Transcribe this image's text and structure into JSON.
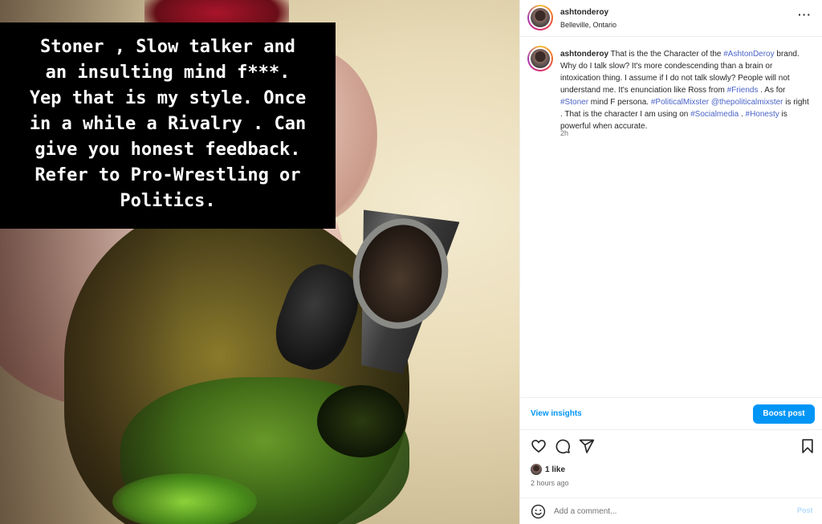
{
  "image_caption": {
    "lines": [
      "Stoner , Slow talker and",
      "an insulting mind f***.",
      "Yep that is my style. Once",
      "in a while a Rivalry . Can",
      "give you honest feedback.",
      "Refer to Pro-Wrestling or",
      "Politics."
    ]
  },
  "header": {
    "username": "ashtonderoy",
    "location": "Belleville, Ontario",
    "more_icon": "more-horizontal-icon",
    "more_glyph": "···"
  },
  "caption_comment": {
    "username": "ashtonderoy",
    "segments": [
      {
        "text": " That is the the Character of the ",
        "tag": false
      },
      {
        "text": "#AshtonDeroy",
        "tag": true
      },
      {
        "text": " brand. Why do I talk slow? It's more condescending than a brain or intoxication thing. I assume if I do not talk slowly? People will not understand me. It's enunciation like Ross from ",
        "tag": false
      },
      {
        "text": "#Friends",
        "tag": true
      },
      {
        "text": " . As for ",
        "tag": false
      },
      {
        "text": "#Stoner",
        "tag": true
      },
      {
        "text": " mind F persona. ",
        "tag": false
      },
      {
        "text": "#PoliticalMixster",
        "tag": true
      },
      {
        "text": " ",
        "tag": false
      },
      {
        "text": "@thepoliticalmixster",
        "tag": true
      },
      {
        "text": " is right . That is the character I am using on ",
        "tag": false
      },
      {
        "text": "#Socialmedia",
        "tag": true
      },
      {
        "text": " . ",
        "tag": false
      },
      {
        "text": "#Honesty",
        "tag": true
      },
      {
        "text": " is powerful when accurate.",
        "tag": false
      }
    ],
    "time": "2h"
  },
  "insights": {
    "view_label": "View insights",
    "boost_label": "Boost post"
  },
  "actions": {
    "like_icon": "heart-icon",
    "comment_icon": "comment-icon",
    "share_icon": "share-icon",
    "save_icon": "bookmark-icon",
    "likes_text": "1 like",
    "posted_time": "2 hours ago"
  },
  "add_comment": {
    "placeholder": "Add a comment...",
    "post_label": "Post",
    "emoji_icon": "emoji-icon"
  },
  "colors": {
    "link_blue": "#0095f6",
    "hashtag": "#4a64c7",
    "muted": "#737373"
  }
}
